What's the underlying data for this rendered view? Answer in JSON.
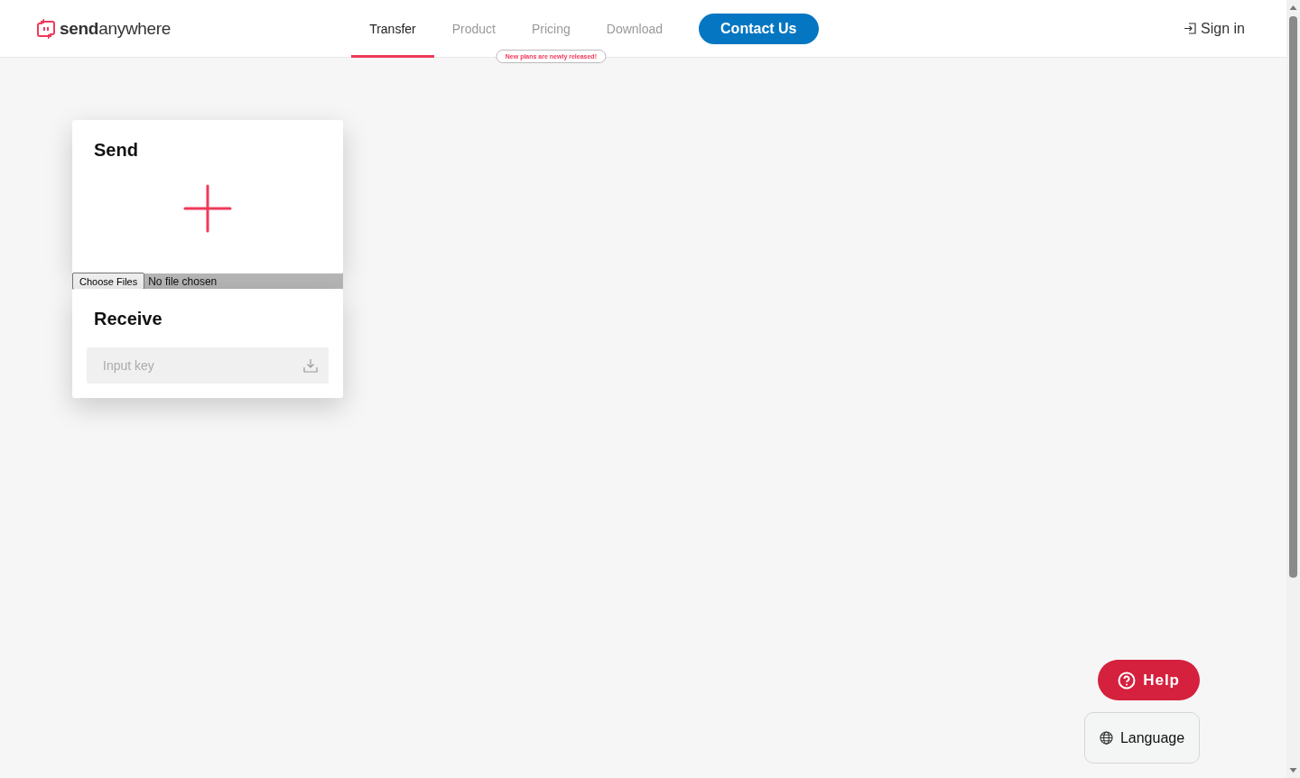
{
  "header": {
    "logo": "**send**anywhere",
    "nav": [
      {
        "label": "Transfer",
        "selected": true
      },
      {
        "label": "Product",
        "selected": false
      },
      {
        "label": "Pricing",
        "selected": false
      },
      {
        "label": "Download",
        "selected": false
      }
    ],
    "pricing_tooltip": "New plans are newly released!",
    "contact_button": "Contact Us",
    "sign_in": "Sign in"
  },
  "send": {
    "title": "Send",
    "file_button": "Choose Files",
    "file_status": "No file chosen"
  },
  "receive": {
    "title": "Receive",
    "placeholder": "Input key"
  },
  "help_button": "Help",
  "language_button": "Language"
}
